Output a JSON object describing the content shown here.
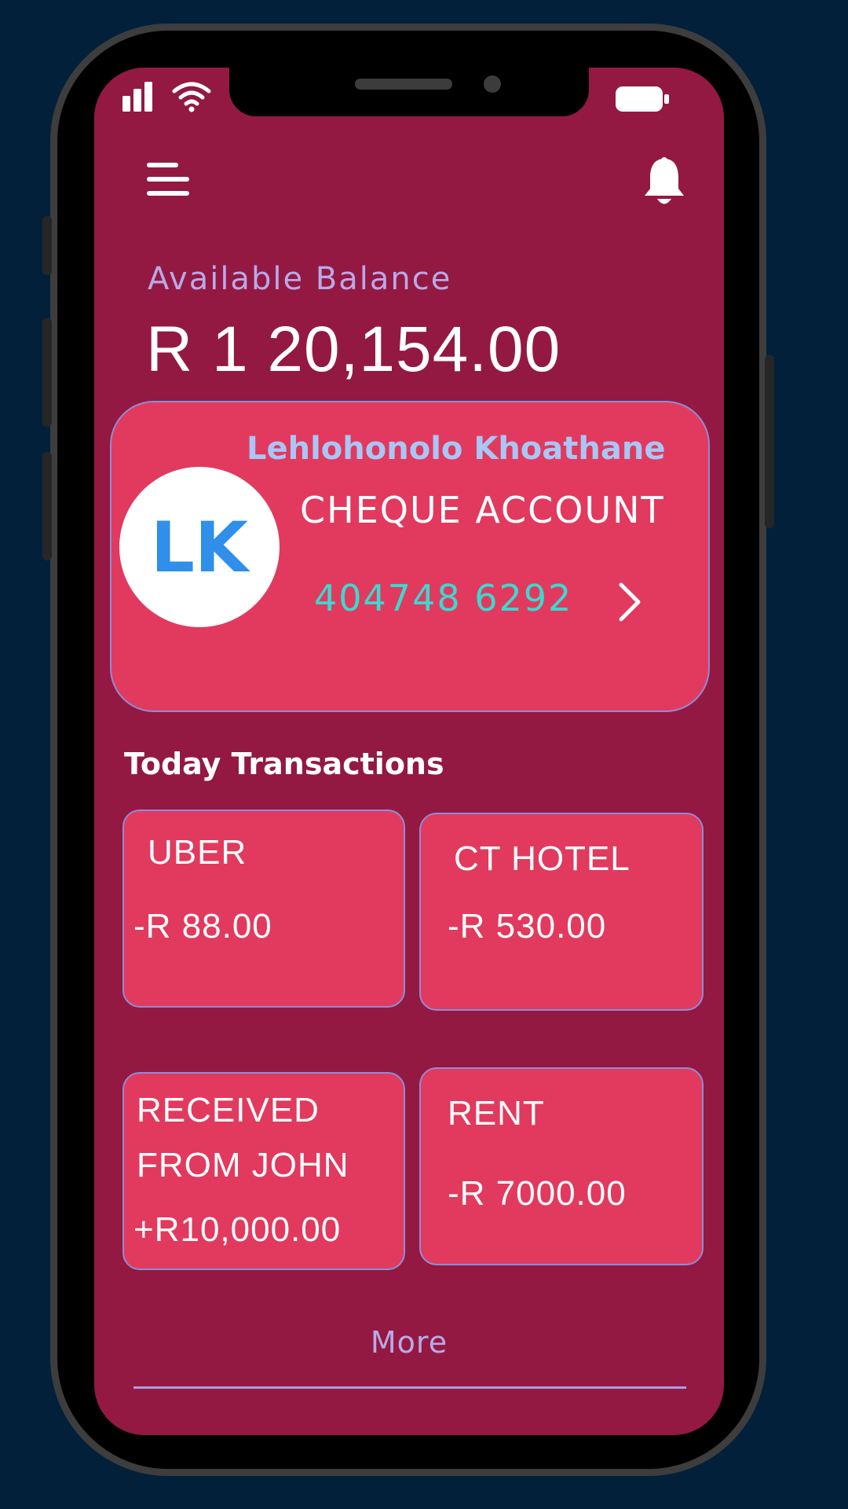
{
  "balance": {
    "label": "Available Balance",
    "amount": "R 1 20,154.00"
  },
  "account": {
    "holder_name": "Lehlohonolo Khoathane",
    "initials": "LK",
    "type": "CHEQUE ACCOUNT",
    "number": "404748 6292"
  },
  "transactions": {
    "heading": "Today Transactions",
    "items": [
      {
        "title": "UBER",
        "amount": "-R 88.00"
      },
      {
        "title": "CT HOTEL",
        "amount": "-R 530.00"
      },
      {
        "title_line1": "RECEIVED",
        "title_line2": "FROM JOHN",
        "amount": "+R10,000.00"
      },
      {
        "title": "RENT",
        "amount": "-R 7000.00"
      }
    ]
  },
  "more_label": "More",
  "icons": {
    "menu": "hamburger-menu-icon",
    "notifications": "bell-icon",
    "signal": "cellular-signal-icon",
    "wifi": "wifi-icon",
    "battery": "battery-icon",
    "account_chevron": "chevron-right-icon"
  },
  "colors": {
    "background": "#03203a",
    "screen": "#931942",
    "card": "#e13a5e",
    "name_accent": "#a9c6f5",
    "account_number": "#3fd7d0",
    "avatar_text": "#2f8fea",
    "muted_label": "#b9a9e8"
  }
}
